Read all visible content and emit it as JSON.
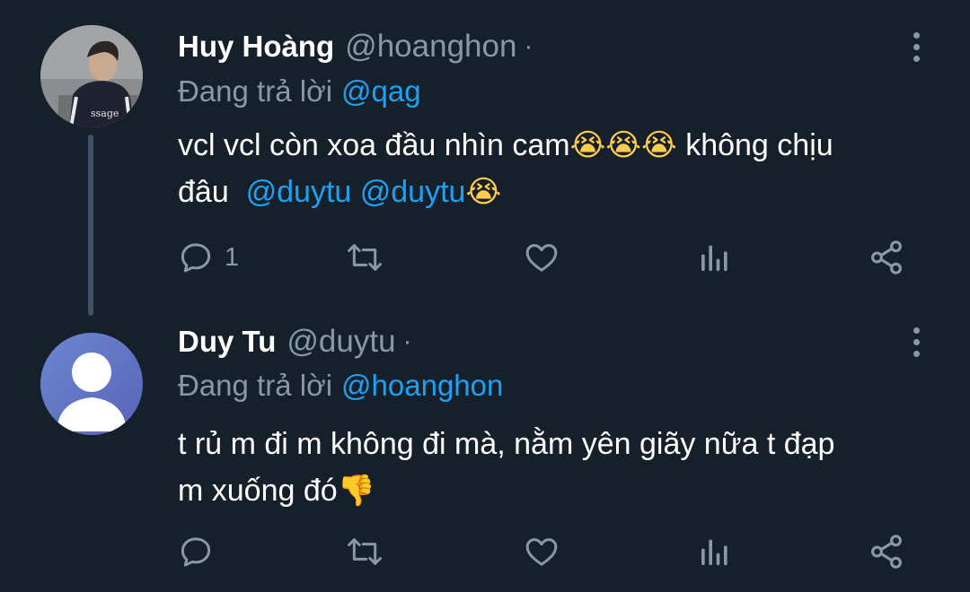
{
  "tweets": [
    {
      "display_name": "Huy Hoàng",
      "handle": "@hoanghon",
      "separator": "·",
      "reply_prefix": "Đang trả lời",
      "reply_to": "@qag",
      "body_lines": [
        {
          "text": "vcl vcl còn xoa đầu nhìn cam",
          "emoji": "😭😭😭",
          "after": " không chịu"
        },
        {
          "text": "đâu  ",
          "mentions": "@duytu @duytu",
          "emoji": "😭"
        }
      ],
      "actions": {
        "reply_count": "1"
      }
    },
    {
      "display_name": "Duy Tu",
      "handle": "@duytu",
      "separator": "·",
      "reply_prefix": "Đang trả lời",
      "reply_to": "@hoanghon",
      "body_lines": [
        {
          "text": "t rủ m đi m không đi mà, nằm yên giãy nữa t đạp"
        },
        {
          "text": "m xuống đó",
          "emoji": "👎"
        }
      ]
    }
  ],
  "colors": {
    "background": "#15202b",
    "text_primary": "#ffffff",
    "text_secondary": "#8899a6",
    "accent": "#1da1f2",
    "thread_line": "#3d5466"
  },
  "icons": {
    "reply": "reply-icon",
    "retweet": "retweet-icon",
    "like": "heart-icon",
    "analytics": "analytics-icon",
    "share": "share-icon",
    "more": "more-vertical-icon"
  }
}
